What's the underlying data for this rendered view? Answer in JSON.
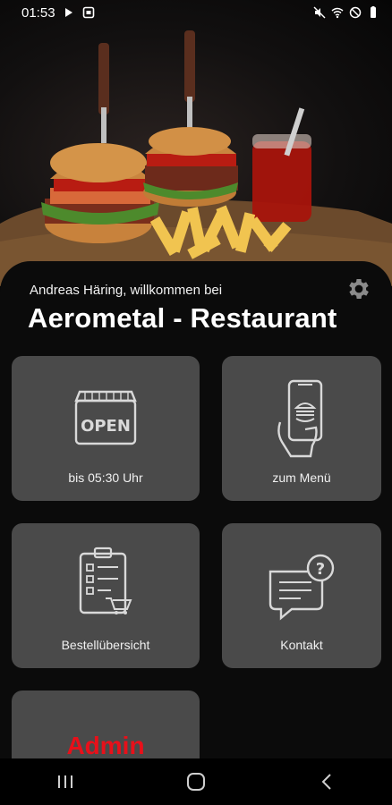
{
  "status_bar": {
    "time": "01:53",
    "icons": [
      "play-icon",
      "screenshot-icon",
      "mute-icon",
      "wifi-icon",
      "dnd-icon",
      "battery-icon"
    ]
  },
  "hero": {
    "image": "burgers-fries-ketchup-photo"
  },
  "header": {
    "welcome_text": "Andreas Häring, willkommen bei",
    "restaurant_name": "Aerometal - Restaurant",
    "settings_icon": "gear-icon"
  },
  "tiles": {
    "hours": {
      "label": "bis 05:30 Uhr",
      "icon": "open-sign-icon"
    },
    "menu": {
      "label": "zum Menü",
      "icon": "phone-burger-icon"
    },
    "orders": {
      "label": "Bestellübersicht",
      "icon": "order-clipboard-icon"
    },
    "contact": {
      "label": "Kontakt",
      "icon": "chat-question-icon"
    },
    "admin": {
      "label": "Admin"
    }
  },
  "nav_bar": {
    "buttons": [
      "recent-apps-icon",
      "home-icon",
      "back-icon"
    ]
  },
  "colors": {
    "background": "#000000",
    "tile": "#4a4a4a",
    "admin_text": "#e8101a"
  }
}
